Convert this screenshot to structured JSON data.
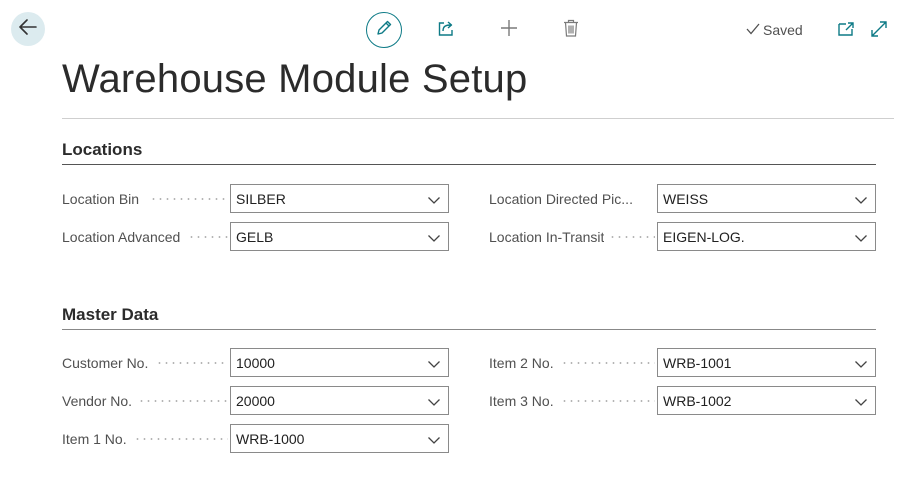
{
  "page": {
    "title": "Warehouse Module Setup"
  },
  "toolbar": {
    "saved_label": "Saved"
  },
  "icons": {
    "back": "arrow-left",
    "edit": "pencil",
    "share": "share",
    "new": "plus",
    "delete": "trash",
    "saved": "checkmark",
    "popout": "open-in-new-window",
    "expand": "expand-diagonal",
    "dropdown": "chevron-down"
  },
  "colors": {
    "accent": "#0d7a86",
    "back_button_bg": "#dcebef"
  },
  "sections": {
    "locations": {
      "title": "Locations",
      "fields": [
        {
          "label": "Location Bin",
          "value": "SILBER"
        },
        {
          "label": "Location Advanced",
          "value": "GELB"
        },
        {
          "label": "Location Directed Pic...",
          "value": "WEISS"
        },
        {
          "label": "Location In-Transit",
          "value": "EIGEN-LOG."
        }
      ]
    },
    "master_data": {
      "title": "Master Data",
      "fields": [
        {
          "label": "Customer No.",
          "value": "10000"
        },
        {
          "label": "Vendor No.",
          "value": "20000"
        },
        {
          "label": "Item 1 No.",
          "value": "WRB-1000"
        },
        {
          "label": "Item 2 No.",
          "value": "WRB-1001"
        },
        {
          "label": "Item 3 No.",
          "value": "WRB-1002"
        }
      ]
    }
  }
}
